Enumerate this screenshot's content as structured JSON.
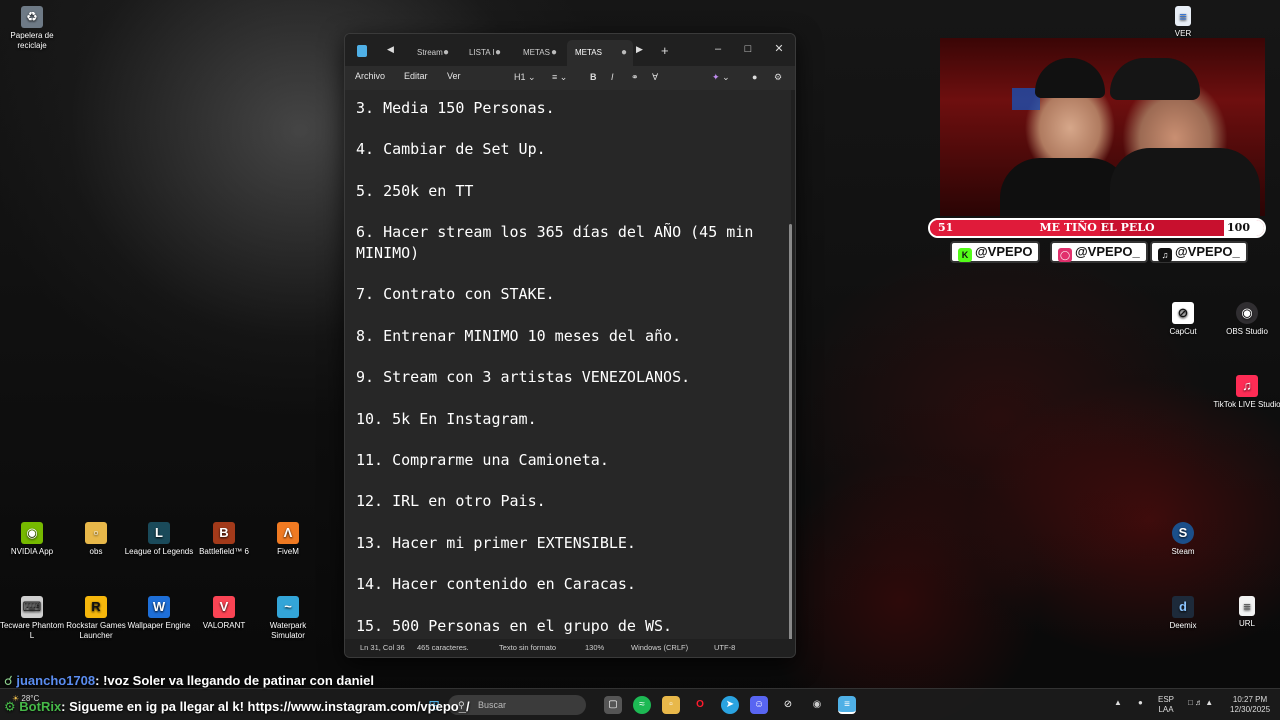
{
  "desktop": {
    "icons": [
      {
        "label": "Papelera de reciclaje",
        "icon": "recycle-bin-icon"
      },
      {
        "label": "NVIDIA App",
        "icon": "nvidia-icon"
      },
      {
        "label": "obs",
        "icon": "folder-icon"
      },
      {
        "label": "League of Legends",
        "icon": "league-icon"
      },
      {
        "label": "Battlefield™ 6",
        "icon": "battlefield-icon"
      },
      {
        "label": "FiveM",
        "icon": "fivem-icon"
      },
      {
        "label": "Tecware Phantom L",
        "icon": "keyboard-icon"
      },
      {
        "label": "Rockstar Games Launcher",
        "icon": "rockstar-icon"
      },
      {
        "label": "Wallpaper Engine",
        "icon": "wallpaper-engine-icon"
      },
      {
        "label": "VALORANT",
        "icon": "valorant-icon"
      },
      {
        "label": "Waterpark Simulator",
        "icon": "waterpark-icon"
      },
      {
        "label": "VER",
        "icon": "document-icon"
      },
      {
        "label": "CapCut",
        "icon": "capcut-icon"
      },
      {
        "label": "OBS Studio",
        "icon": "obs-icon"
      },
      {
        "label": "TikTok LIVE Studio",
        "icon": "tiktok-icon"
      },
      {
        "label": "Steam",
        "icon": "steam-icon"
      },
      {
        "label": "Deemix",
        "icon": "deemix-icon"
      },
      {
        "label": "URL",
        "icon": "url-file-icon"
      }
    ]
  },
  "notepad": {
    "tabs": [
      {
        "label": "Stream"
      },
      {
        "label": "LISTA I"
      },
      {
        "label": "METAS"
      },
      {
        "label": "METAS"
      }
    ],
    "menu": {
      "file": "Archivo",
      "edit": "Editar",
      "view": "Ver"
    },
    "toolbar": {
      "heading": "H1"
    },
    "lines": [
      "3. Media 150 Personas.",
      "",
      "4. Cambiar de Set Up.",
      "",
      "5. 250k en TT",
      "",
      "6. Hacer stream los 365 días del AÑO (45 min MINIMO)",
      "",
      "7. Contrato con STAKE.",
      "",
      "8. Entrenar MINIMO 10 meses del año.",
      "",
      "9. Stream con 3 artistas VENEZOLANOS.",
      "",
      "10. 5k En Instagram.",
      "",
      "11. Comprarme una Camioneta.",
      "",
      "12. IRL en otro Pais.",
      "",
      "13. Hacer mi primer EXTENSIBLE.",
      "",
      "14. Hacer contenido en Caracas.",
      "",
      "15. 500 Personas en el grupo de WS."
    ],
    "status": {
      "position": "Ln 31, Col 36",
      "chars": "465 caracteres.",
      "format": "Texto sin formato",
      "zoom": "130%",
      "line_endings": "Windows (CRLF)",
      "encoding": "UTF-8"
    }
  },
  "overlay": {
    "goal": {
      "current": "51",
      "title": "ME TIÑO EL PELO",
      "target": "100",
      "progress": 0.51
    },
    "socials": [
      {
        "handle": "@VPEPO",
        "icon": "kick-icon"
      },
      {
        "handle": "@VPEPO_",
        "icon": "instagram-icon"
      },
      {
        "handle": "@VPEPO_",
        "icon": "tiktok-icon"
      }
    ],
    "chat": [
      {
        "user": "juancho1708",
        "message": ": !voz Soler va llegando de patinar con daniel"
      },
      {
        "user": "BotRix",
        "message": ": Sigueme en ig pa llegar al k! https://www.instagram.com/vpepo_/"
      }
    ]
  },
  "taskbar": {
    "weather": "28°C",
    "search_placeholder": "Buscar",
    "lang": "ESP",
    "lang_sub": "LAA",
    "time": "10:27 PM",
    "date": "12/30/2025"
  }
}
